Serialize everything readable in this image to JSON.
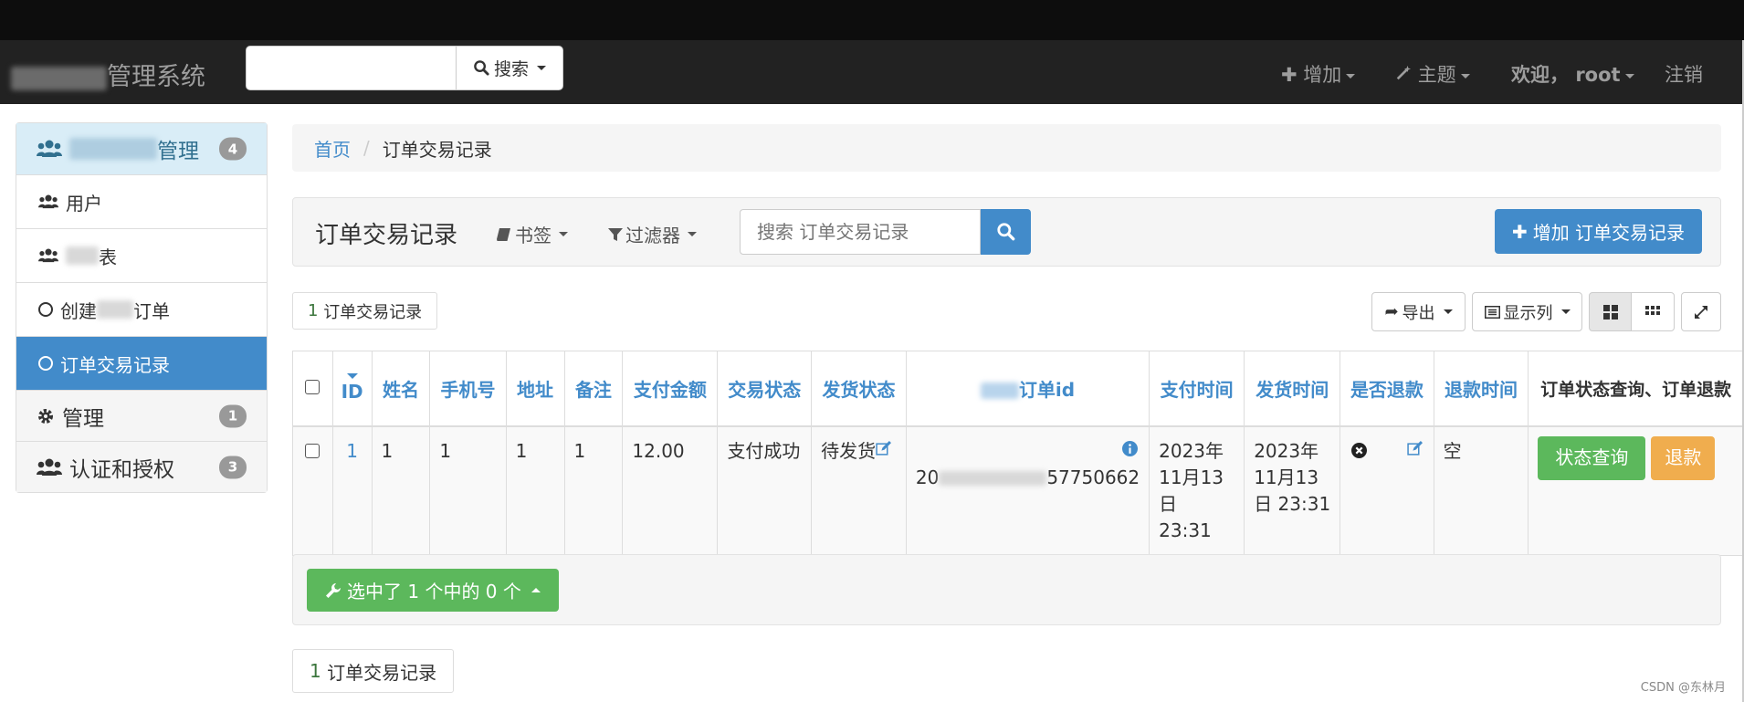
{
  "navbar": {
    "brand_suffix": "管理系统",
    "search_label": "搜索",
    "add_label": "增加",
    "theme_label": "主题",
    "welcome_label": "欢迎，",
    "user": "root",
    "logout_label": "注销"
  },
  "sidebar": {
    "head": {
      "label_suffix": "管理",
      "badge": "4"
    },
    "items": [
      {
        "label": "用户"
      },
      {
        "label_suffix": "表"
      },
      {
        "label_prefix": "创建",
        "label_suffix": "订单"
      },
      {
        "label": "订单交易记录"
      }
    ],
    "sections": [
      {
        "label": "管理",
        "badge": "1"
      },
      {
        "label": "认证和授权",
        "badge": "3"
      }
    ]
  },
  "breadcrumb": {
    "home": "首页",
    "current": "订单交易记录"
  },
  "panel": {
    "title": "订单交易记录",
    "bookmarks_label": "书签",
    "filter_label": "过滤器",
    "search_placeholder": "搜索 订单交易记录",
    "add_label": "增加 订单交易记录"
  },
  "list": {
    "count_num": "1",
    "count_text": "订单交易记录",
    "export_label": "导出",
    "columns_label": "显示列"
  },
  "table": {
    "headers": {
      "id": "ID",
      "name": "姓名",
      "phone": "手机号",
      "address": "地址",
      "note": "备注",
      "amount": "支付金额",
      "trade_status": "交易状态",
      "ship_status": "发货状态",
      "order_id_suffix": "订单id",
      "pay_time": "支付时间",
      "ship_time": "发货时间",
      "refunded": "是否退款",
      "refund_time": "退款时间",
      "actions": "订单状态查询、订单退款"
    },
    "rows": [
      {
        "id": "1",
        "name": "1",
        "phone": "1",
        "address": "1",
        "note": "1",
        "amount": "12.00",
        "trade_status": "支付成功",
        "ship_status": "待发货",
        "order_id_prefix": "20",
        "order_id_suffix": "57750662",
        "pay_time": [
          "2023年",
          "11月13",
          "日 23:31"
        ],
        "ship_time": [
          "2023年",
          "11月13",
          "日 23:31"
        ],
        "refund_time": "空",
        "query_label": "状态查询",
        "refund_label": "退款"
      }
    ]
  },
  "actions": {
    "selected_label": "选中了 1 个中的 0 个"
  },
  "footer": {
    "count_num": "1",
    "count_text": "订单交易记录"
  },
  "watermark": "CSDN @东林月",
  "colors": {
    "primary": "#428bca",
    "success": "#5cb85c",
    "warning": "#f0ad4e",
    "navbar": "#222222"
  }
}
